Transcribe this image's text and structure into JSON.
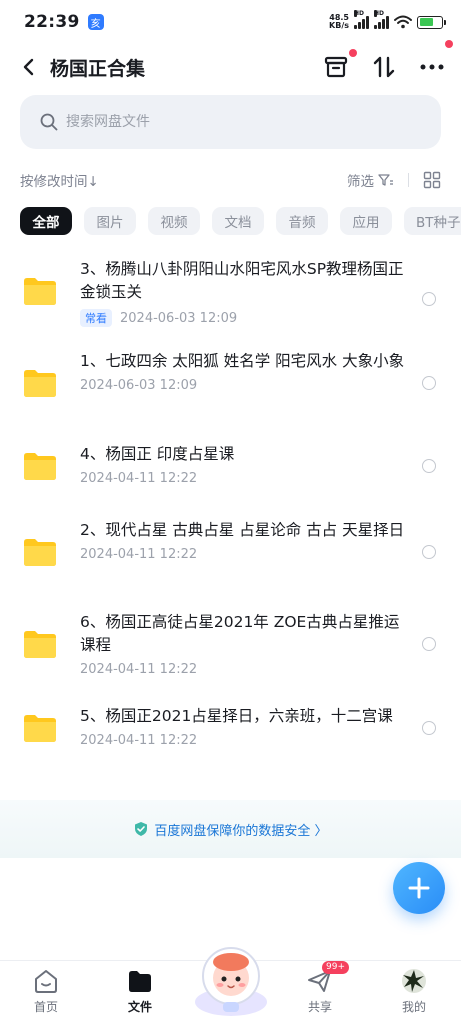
{
  "status_bar": {
    "time": "22:39",
    "app_icon_glyph": "亥",
    "net_speed_value": "48.5",
    "net_speed_unit": "KB/s",
    "hd_label": "HD",
    "battery_level": 0.65
  },
  "header": {
    "title": "杨国正合集"
  },
  "search": {
    "placeholder": "搜索网盘文件"
  },
  "sort": {
    "label": "按修改时间↓",
    "filter_label": "筛选"
  },
  "chips": [
    "全部",
    "图片",
    "视频",
    "文档",
    "音频",
    "应用",
    "BT种子"
  ],
  "files": [
    {
      "name": "3、杨腾山八卦阴阳山水阳宅风水SP教理杨国正金锁玉关",
      "tag": "常看",
      "date": "2024-06-03  12:09"
    },
    {
      "name": "1、七政四余 太阳狐 姓名学 阳宅风水 大象小象",
      "tag": "",
      "date": "2024-06-03  12:09"
    },
    {
      "name": "4、杨国正 印度占星课",
      "tag": "",
      "date": "2024-04-11  12:22"
    },
    {
      "name": "2、现代占星 古典占星 占星论命 古占 天星择日",
      "tag": "",
      "date": "2024-04-11  12:22"
    },
    {
      "name": "6、杨国正高徒占星2021年 ZOE古典占星推运课程",
      "tag": "",
      "date": "2024-04-11  12:22"
    },
    {
      "name": "5、杨国正2021占星择日，六亲班，十二宫课",
      "tag": "",
      "date": "2024-04-11  12:22"
    }
  ],
  "security_banner": {
    "text": "百度网盘保障你的数据安全 〉"
  },
  "bottom_nav": {
    "home": "首页",
    "files": "文件",
    "share": "共享",
    "share_badge": "99+",
    "me": "我的"
  },
  "colors": {
    "accent": "#2f7bff",
    "active_chip": "#101318",
    "red_dot": "#f5405e",
    "folder": "#ffc81e"
  }
}
